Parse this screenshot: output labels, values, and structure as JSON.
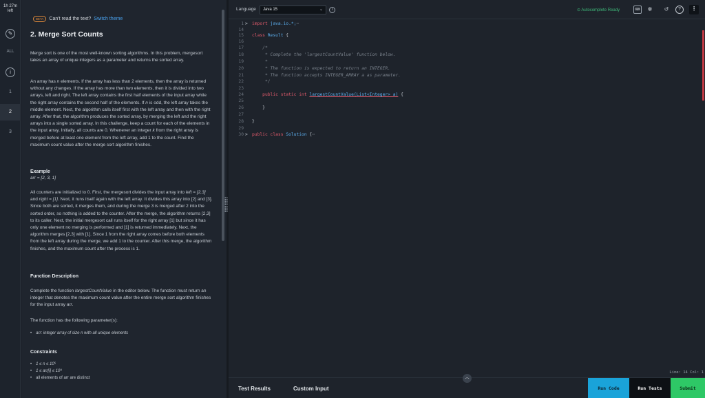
{
  "rail": {
    "timer_line1": "1h 27m",
    "timer_line2": "left",
    "all_label": "ALL",
    "problems": [
      "1",
      "2",
      "3"
    ],
    "active_problem": "2"
  },
  "problem": {
    "beta_badge": "BETA",
    "switch_prompt": "Can't read the text?",
    "switch_link": "Switch theme",
    "title": "2. Merge Sort Counts",
    "intro": "Merge sort is one of the most well-known sorting algorithms. In this problem, mergesort takes an array of unique integers as a parameter and returns the sorted array.",
    "description": [
      "An array has ",
      "n",
      " elements. If the array has less than 2 elements, then the array is returned without any changes. If the array has more than two elements, then it is divided into two arrays, left and right. The left array contains the first half elements of the input array while the right array contains the second half of the elements. If ",
      "n",
      " is odd, the left array takes the middle element. Next, the algorithm calls itself first with the left array and then with the right array. After that, the algorithm produces the sorted array, by merging the left and the right arrays into a single sorted array. In this challenge, keep a count for each of the elements in the input array. Initially, all counts are 0. Whenever an integer ",
      "k",
      " from the right array is merged before at least one element from the left array, add 1 to the count. Find the maximum count value after the merge sort algorithm finishes."
    ],
    "example_heading": "Example",
    "example_value": "arr = [2, 3, 1]",
    "example_explanation": [
      "All counters are initialized to 0. First, the mergesort divides the input array into ",
      "left = [2,3]",
      " and ",
      "right = [1]",
      ". Next, it runs itself again with the left array. It divides this array into [2] and [3]. Since both are sorted, it merges them, and during the merge 3 is merged after 2 into the sorted order, so nothing is added to the counter. After the merge, the algorithm returns [2,3] to its caller. Next, the initial mergesort call runs itself for the right array [1] but since it has only one element no merging is performed and [1] is returned immediately. Next, the algorithm merges [2,3] with [1]. Since 1 from the right array comes before both elements from the left array during the merge, we add 1 to the counter. After this merge, the algorithm finishes, and the maximum count after the process is 1."
    ],
    "function_heading": "Function Description",
    "function_desc": [
      "Complete the function ",
      "largestCountValue",
      " in the editor below. The function must return an integer that denotes the maximum count value after the entire merge sort algorithm finishes for the input array ",
      "arr",
      "."
    ],
    "params_intro": "The function has the following parameter(s):",
    "params": [
      "arr: integer array of size n with all unique elements"
    ],
    "constraints_heading": "Constraints",
    "constraints": [
      "1 ≤ n ≤ 10⁵",
      "1 ≤ arr[i] ≤ 10⁹",
      "all elements of arr are distinct"
    ]
  },
  "editor": {
    "language_label": "Language",
    "language_value": "Java 15",
    "autocomplete_status": "Autocomplete Ready",
    "cursor_position": "Line: 14 Col: 1",
    "lines": [
      {
        "n": "1",
        "fold": ">",
        "parts": [
          [
            "kw",
            "import"
          ],
          [
            "pl",
            " "
          ],
          [
            "nm",
            "java.io.*;"
          ],
          [
            "cm",
            "⋯"
          ]
        ]
      },
      {
        "n": "14",
        "fold": "",
        "parts": []
      },
      {
        "n": "15",
        "fold": "",
        "parts": [
          [
            "kw",
            "class"
          ],
          [
            "pl",
            " "
          ],
          [
            "nm",
            "Result"
          ],
          [
            "pl",
            " {"
          ]
        ]
      },
      {
        "n": "16",
        "fold": "",
        "parts": []
      },
      {
        "n": "17",
        "fold": "",
        "parts": [
          [
            "cm",
            "    /*"
          ]
        ]
      },
      {
        "n": "18",
        "fold": "",
        "parts": [
          [
            "cm",
            "     * Complete the 'largestCountValue' function below."
          ]
        ]
      },
      {
        "n": "19",
        "fold": "",
        "parts": [
          [
            "cm",
            "     *"
          ]
        ]
      },
      {
        "n": "20",
        "fold": "",
        "parts": [
          [
            "cm",
            "     * The function is expected to return an INTEGER."
          ]
        ]
      },
      {
        "n": "21",
        "fold": "",
        "parts": [
          [
            "cm",
            "     * The function accepts INTEGER_ARRAY a as parameter."
          ]
        ]
      },
      {
        "n": "22",
        "fold": "",
        "parts": [
          [
            "cm",
            "     */"
          ]
        ]
      },
      {
        "n": "23",
        "fold": "",
        "parts": []
      },
      {
        "n": "24",
        "fold": "",
        "parts": [
          [
            "pl",
            "    "
          ],
          [
            "kw",
            "public static int"
          ],
          [
            "pl",
            " "
          ],
          [
            "fn",
            "largestCountValue(List<Integer> a)"
          ],
          [
            "pl",
            " {"
          ]
        ]
      },
      {
        "n": "25",
        "fold": "",
        "parts": []
      },
      {
        "n": "26",
        "fold": "",
        "parts": [
          [
            "pl",
            "    }"
          ]
        ]
      },
      {
        "n": "27",
        "fold": "",
        "parts": []
      },
      {
        "n": "28",
        "fold": "",
        "parts": [
          [
            "pl",
            "}"
          ]
        ]
      },
      {
        "n": "29",
        "fold": "",
        "parts": []
      },
      {
        "n": "30",
        "fold": ">",
        "parts": [
          [
            "kw",
            "public class"
          ],
          [
            "pl",
            " "
          ],
          [
            "nm",
            "Solution"
          ],
          [
            "pl",
            " {"
          ],
          [
            "cm",
            "⋯"
          ]
        ]
      }
    ]
  },
  "bottom": {
    "tab_results": "Test Results",
    "tab_custom": "Custom Input",
    "run_code": "Run Code",
    "run_tests": "Run Tests",
    "submit": "Submit"
  }
}
